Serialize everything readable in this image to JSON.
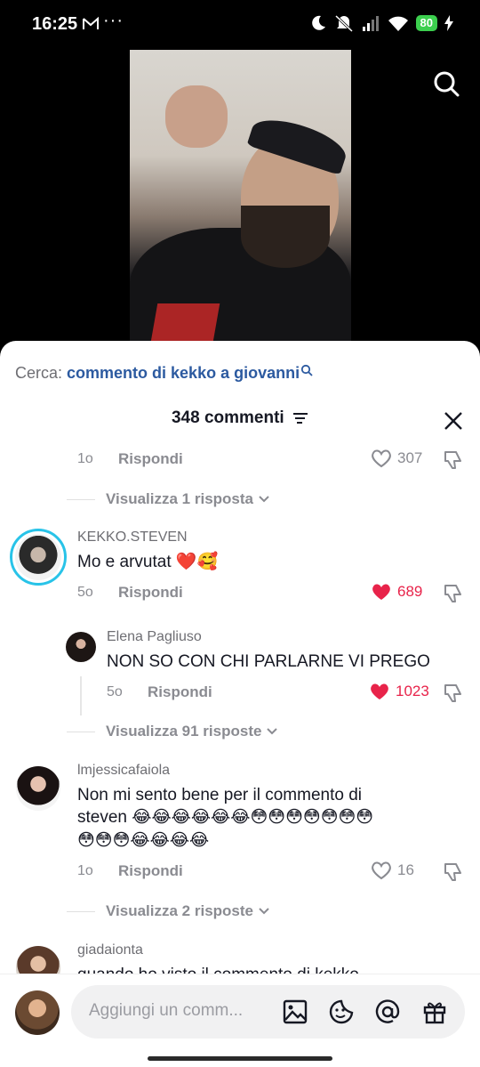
{
  "status_bar": {
    "time": "16:25",
    "battery": "80"
  },
  "search": {
    "label": "Cerca:",
    "query": "commento di kekko a giovanni"
  },
  "comments_header": {
    "title": "348 commenti"
  },
  "previous_comment": {
    "time": "1o",
    "reply_label": "Rispondi",
    "likes": "307",
    "view_replies": "Visualizza 1 risposta"
  },
  "comments": [
    {
      "username": "KEKKO.STEVEN",
      "text": "Mo e arvutat ❤️🥰",
      "time": "5o",
      "reply_label": "Rispondi",
      "likes": "689",
      "liked": true
    },
    {
      "username": "Elena Pagliuso",
      "text": "NON SO CON CHI PARLARNE VI PREGO",
      "time": "5o",
      "reply_label": "Rispondi",
      "likes": "1023",
      "liked": true,
      "view_replies": "Visualizza 91 risposte"
    },
    {
      "username": "lmjessicafaiola",
      "text_line1": "Non mi sento bene per il commento di",
      "text_line2": "steven 😂😂😂😂😂😂😳😳😳😳😳😳😳",
      "text_line3": "😳😳😳😂😂😂😂",
      "time": "1o",
      "reply_label": "Rispondi",
      "likes": "16",
      "liked": false,
      "view_replies": "Visualizza 2 risposte"
    },
    {
      "username": "giadaionta",
      "text": "quando ho visto il commento di kekko"
    }
  ],
  "composer": {
    "placeholder": "Aggiungi un comm..."
  },
  "colors": {
    "accent_blue": "#2c5aa0",
    "like_red": "#e8234a",
    "battery_green": "#3ccf4e"
  },
  "icons": [
    "mail-icon",
    "search-icon",
    "filter-icon",
    "close-icon",
    "heart-icon",
    "dislike-icon",
    "chevron-down-icon",
    "image-icon",
    "emoji-icon",
    "at-icon",
    "gift-icon"
  ]
}
